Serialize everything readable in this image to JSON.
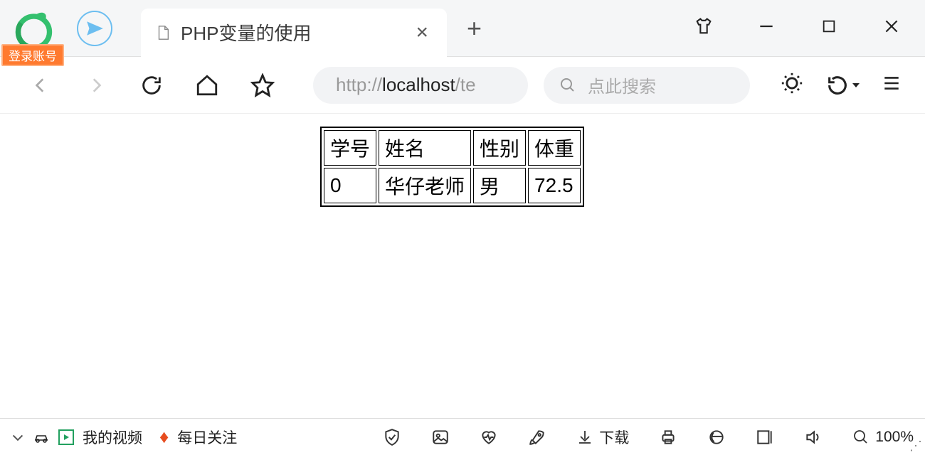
{
  "titlebar": {
    "login_badge": "登录账号",
    "tab_title": "PHP变量的使用"
  },
  "toolbar": {
    "url_protocol": "http://",
    "url_host": "localhost",
    "url_rest": "/te",
    "search_placeholder": "点此搜索"
  },
  "page_table": {
    "headers": [
      "学号",
      "姓名",
      "性别",
      "体重"
    ],
    "rows": [
      [
        "0",
        "华仔老师",
        "男",
        "72.5"
      ]
    ]
  },
  "statusbar": {
    "my_video": "我的视频",
    "daily_focus": "每日关注",
    "download": "下载",
    "zoom": "100%"
  }
}
